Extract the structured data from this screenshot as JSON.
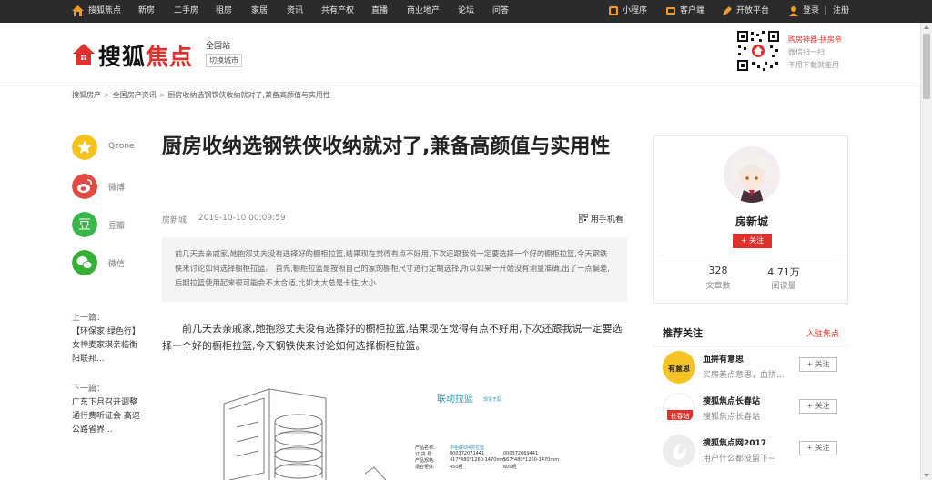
{
  "topnav": {
    "left": [
      "搜狐焦点",
      "新房",
      "二手房",
      "租房",
      "家居",
      "资讯",
      "共有产权",
      "直播",
      "商业地产",
      "论坛",
      "问答"
    ],
    "right": [
      "小程序",
      "客户端",
      "开放平台",
      "登录",
      "注册"
    ],
    "right_sep": "|"
  },
  "header": {
    "logo_part1": "搜狐",
    "logo_part2": "焦点",
    "site_label": "全国站",
    "switch_city": "切换城市",
    "promo_title": "购房神器-拼房帝",
    "promo_line2": "微信扫一扫",
    "promo_line3": "不用下载就能用"
  },
  "breadcrumb": {
    "items": [
      "搜狐房产",
      "全国房产资讯",
      "厨房收纳选钢铁侠收纳就对了,兼备高颜值与实用性"
    ],
    "sep": ">"
  },
  "share": {
    "items": [
      {
        "label": "Qzone",
        "glyph": "★",
        "color": "#f5c31c"
      },
      {
        "label": "微博",
        "glyph": "◉",
        "color": "#e14b44"
      },
      {
        "label": "豆瓣",
        "glyph": "豆",
        "color": "#39b54a"
      },
      {
        "label": "微信",
        "glyph": "✉",
        "color": "#35b034"
      }
    ]
  },
  "prev": {
    "title": "上一篇：",
    "text": "【环保家 绿色行】女神麦家琪亲临衡阳联邦..."
  },
  "next": {
    "title": "下一篇：",
    "text": "广东下月召开调整通行费听证会 高速公路省界..."
  },
  "article": {
    "title": "厨房收纳选钢铁侠收纳就对了,兼备高颜值与实用性",
    "source": "房新城",
    "date": "2019-10-10 00:09:59",
    "phone_read": "用手机看",
    "summary": "前几天去亲戚家,她抱怨丈夫没有选择好的橱柜拉篮,结果现在觉得有点不好用,下次还跟我说一定要选择一个好的橱柜拉篮,今天钢铁侠来讨论如何选择橱柜拉篮。 首先,橱柜拉篮是按照自己的家的橱柜尺寸进行定制选择,所以如果一开始没有测量准确,出了一点偏差,后期拉篮使用起来很可能会不太合适,比如太大总是卡住,太小",
    "body": "前几天去亲戚家,她抱怨丈夫没有选择好的橱柜拉篮,结果现在觉得有点不好用,下次还跟我说一定要选择一个好的橱柜拉篮,今天钢铁侠来讨论如何选择橱柜拉篮。",
    "figure": {
      "title": "联动拉篮",
      "subtitle": "现货于配",
      "spec_labels": [
        "产品名称:",
        "订 货 号:",
        "产品规格:",
        "适合柜体:"
      ],
      "spec_col1": [
        "中柜联动4层拉篮",
        "000372071441",
        "417*480*1260-1470mm",
        "450柜"
      ],
      "spec_col2": [
        "",
        "000372069441",
        "567*480*1260-1470mm",
        "600柜"
      ]
    }
  },
  "author": {
    "name": "房新城",
    "follow": "+ 关注",
    "articles_num": "328",
    "articles_label": "文章数",
    "reads_num": "4.71万",
    "reads_label": "阅读量"
  },
  "recommend": {
    "title": "推荐关注",
    "link": "入驻焦点",
    "items": [
      {
        "name": "血拼有意思",
        "desc": "买房差点意思，血拼...",
        "follow": "+ 关注",
        "logo_text": "有意思",
        "logo_bg": "#f6c324",
        "logo_color": "#222"
      },
      {
        "name": "搜狐焦点长春站",
        "desc": "搜狐焦点长春站",
        "follow": "+ 关注",
        "logo_text": "长春站",
        "logo_bg": "#ffffff",
        "logo_color": "#e0312d"
      },
      {
        "name": "搜狐焦点网2017",
        "desc": "用户什么都没留下~",
        "follow": "+ 关注",
        "logo_text": "",
        "logo_bg": "#ececec",
        "logo_color": "#fff"
      }
    ]
  },
  "colors": {
    "brand_red": "#e0312d",
    "nav_bg": "#2b2b2b",
    "cyan": "#2a9ab8"
  }
}
